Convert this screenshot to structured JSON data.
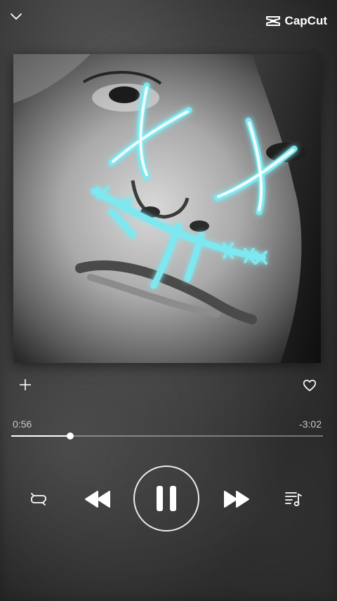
{
  "header": {
    "collapse_icon": "chevron-down-icon",
    "watermark": {
      "icon": "capcut-logo-icon",
      "text": "CapCut"
    }
  },
  "artwork": {
    "description_icon": "album-artwork-image"
  },
  "actions": {
    "add_icon": "plus-icon",
    "like_icon": "heart-outline-icon"
  },
  "playback": {
    "elapsed": "0:56",
    "remaining": "-3:02",
    "progress_fraction": 0.19
  },
  "controls": {
    "repeat_icon": "repeat-icon",
    "previous_icon": "rewind-icon",
    "play_pause_icon": "pause-icon",
    "next_icon": "fast-forward-icon",
    "queue_icon": "playlist-queue-icon"
  },
  "colors": {
    "foreground": "#ffffff",
    "accent_glow": "#7ee8f0",
    "muted_text": "#c9c9c9"
  }
}
